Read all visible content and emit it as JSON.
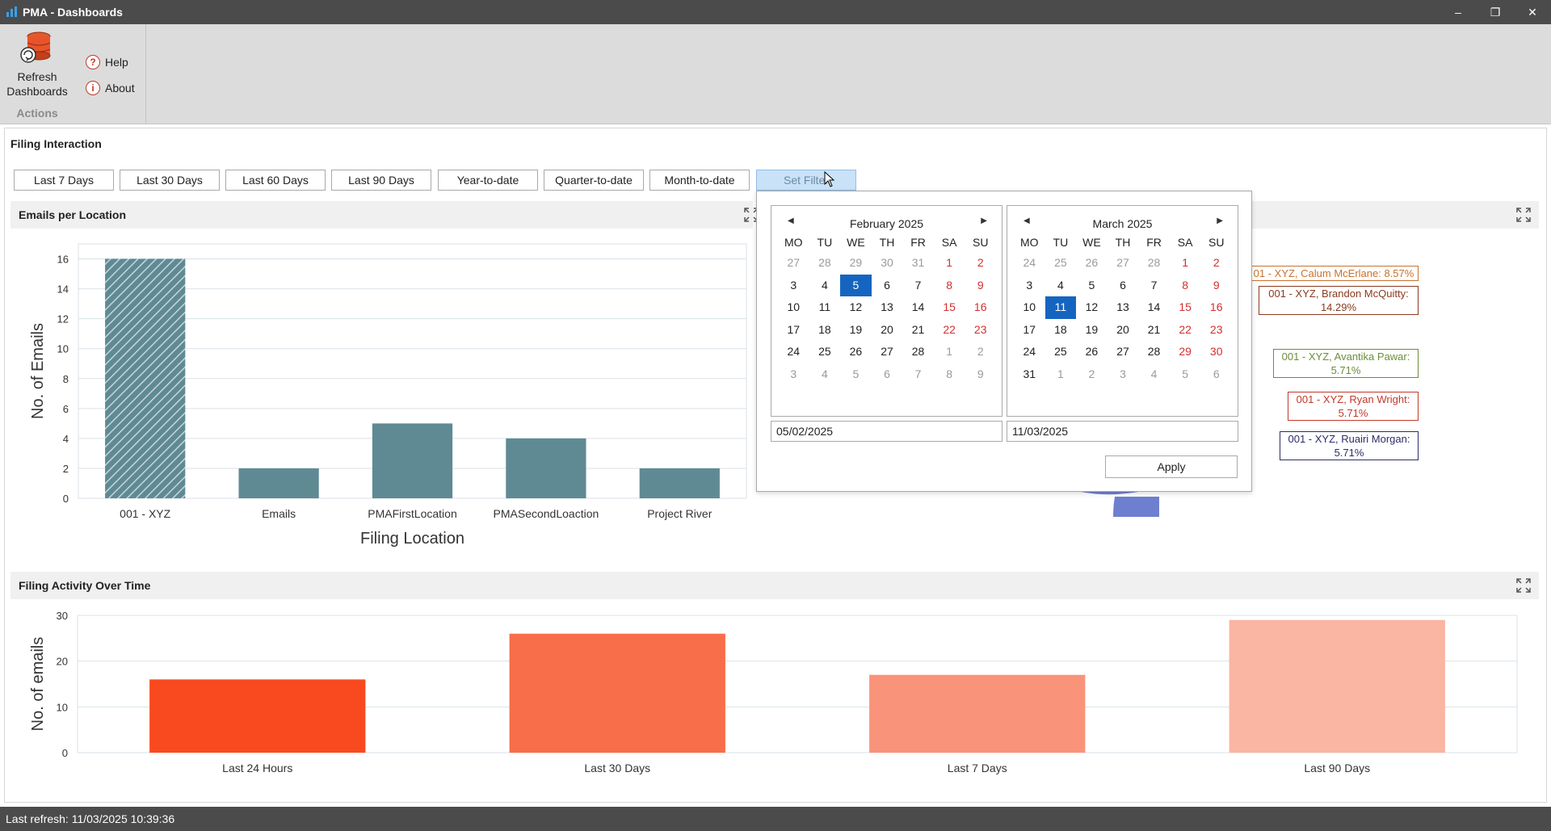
{
  "window": {
    "title": "PMA - Dashboards",
    "minimize": "–",
    "restore": "❐",
    "close": "✕"
  },
  "ribbon": {
    "refresh_label_1": "Refresh",
    "refresh_label_2": "Dashboards",
    "help_label": "Help",
    "about_label": "About",
    "group_label": "Actions"
  },
  "section": {
    "title": "Filing Interaction"
  },
  "filters": [
    "Last 7 Days",
    "Last 30 Days",
    "Last 60 Days",
    "Last 90 Days",
    "Year-to-date",
    "Quarter-to-date",
    "Month-to-date",
    "Set Filter"
  ],
  "active_filter": "Set Filter",
  "panels": {
    "emails_per_location": "Emails per Location",
    "filing_activity": "Filing Activity Over Time"
  },
  "date_popup": {
    "weekday_headers": [
      "MO",
      "TU",
      "WE",
      "TH",
      "FR",
      "SA",
      "SU"
    ],
    "calendars": [
      {
        "month_label": "February 2025",
        "weeks": [
          [
            "27",
            "28",
            "29",
            "30",
            "31",
            "1",
            "2"
          ],
          [
            "3",
            "4",
            "5",
            "6",
            "7",
            "8",
            "9"
          ],
          [
            "10",
            "11",
            "12",
            "13",
            "14",
            "15",
            "16"
          ],
          [
            "17",
            "18",
            "19",
            "20",
            "21",
            "22",
            "23"
          ],
          [
            "24",
            "25",
            "26",
            "27",
            "28",
            "1",
            "2"
          ],
          [
            "3",
            "4",
            "5",
            "6",
            "7",
            "8",
            "9"
          ]
        ],
        "selected_day": "5",
        "input_value": "05/02/2025"
      },
      {
        "month_label": "March 2025",
        "weeks": [
          [
            "24",
            "25",
            "26",
            "27",
            "28",
            "1",
            "2"
          ],
          [
            "3",
            "4",
            "5",
            "6",
            "7",
            "8",
            "9"
          ],
          [
            "10",
            "11",
            "12",
            "13",
            "14",
            "15",
            "16"
          ],
          [
            "17",
            "18",
            "19",
            "20",
            "21",
            "22",
            "23"
          ],
          [
            "24",
            "25",
            "26",
            "27",
            "28",
            "29",
            "30"
          ],
          [
            "31",
            "1",
            "2",
            "3",
            "4",
            "5",
            "6"
          ]
        ],
        "selected_day": "11",
        "input_value": "11/03/2025"
      }
    ],
    "apply_label": "Apply"
  },
  "pie_labels": [
    {
      "line1": "01 - XYZ, Calum McErlane: 8.57%",
      "line2": "",
      "color": "#c8722e"
    },
    {
      "line1": "001 - XYZ, Brandon McQuitty:",
      "line2": "14.29%",
      "color": "#8a3a1e"
    },
    {
      "line1": "001 - XYZ, Avantika Pawar:",
      "line2": "5.71%",
      "color": "#6b8e3a"
    },
    {
      "line1": "001 - XYZ, Ryan Wright:",
      "line2": "5.71%",
      "color": "#c0392b"
    },
    {
      "line1": "001 - XYZ, Ruairi Morgan:",
      "line2": "5.71%",
      "color": "#2c2c6a"
    }
  ],
  "colors": {
    "bar_primary": "#5f8a94",
    "activity_bars": [
      "#f94a1f",
      "#f86d4a",
      "#f9937a",
      "#fab5a3"
    ],
    "grid": "#d9e2e8",
    "pie_blue": "#6f7fd0",
    "pie_green": "#8fa661",
    "pie_red": "#c4424c",
    "pie_dark": "#3d3f8a",
    "pie_brown": "#b2604a"
  },
  "status": {
    "text": "Last refresh: 11/03/2025 10:39:36"
  },
  "chart_data": [
    {
      "type": "bar",
      "title": "Emails per Location",
      "categories": [
        "001 - XYZ",
        "Emails",
        "PMAFirstLocation",
        "PMASecondLoaction",
        "Project River"
      ],
      "values": [
        16,
        2,
        5,
        4,
        2
      ],
      "highlighted_index": 0,
      "xlabel": "Filing Location",
      "ylabel": "No. of Emails",
      "ylim": [
        0,
        17
      ],
      "yticks": [
        0,
        2,
        4,
        6,
        8,
        10,
        12,
        14,
        16
      ],
      "grid": true
    },
    {
      "type": "bar",
      "title": "Filing Activity Over Time",
      "categories": [
        "Last 24 Hours",
        "Last 30 Days",
        "Last 7 Days",
        "Last 90 Days"
      ],
      "values": [
        16,
        26,
        17,
        29
      ],
      "xlabel": "",
      "ylabel": "No. of emails",
      "ylim": [
        0,
        30
      ],
      "yticks": [
        0,
        10,
        20,
        30
      ],
      "grid": true
    }
  ]
}
